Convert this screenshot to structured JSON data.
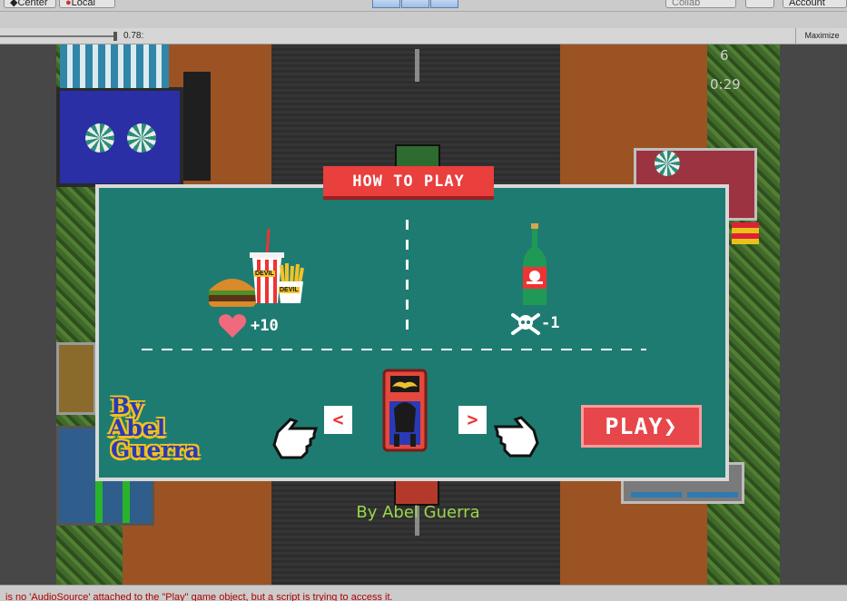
{
  "editor": {
    "pivot_label": "Center",
    "space_label": "Local",
    "collab_label": "Collab",
    "account_label": "Account",
    "scale_value": "0.78:",
    "maximize_label": "Maximize",
    "console_message": "is no 'AudioSource' attached to the \"Play\" game object, but a script is trying to access it."
  },
  "game": {
    "hud_count": "6",
    "hud_timer": "0:29",
    "credit": "By Abel Guerra"
  },
  "how_to_play": {
    "title": "HOW TO PLAY",
    "food_brand_1": "DEVIL",
    "food_brand_2": "DEVIL",
    "food_points": "+10",
    "poison_points": "-1",
    "left_arrow": "<",
    "right_arrow": ">",
    "play_label": "PLAY",
    "play_chevron": "❯",
    "byline": [
      "By",
      "Abel",
      "Guerra"
    ]
  },
  "colors": {
    "panel": "#1e7b72",
    "title_bg": "#e93f3d",
    "play_bg": "#e7474a",
    "credit_text": "#9ad64a"
  }
}
